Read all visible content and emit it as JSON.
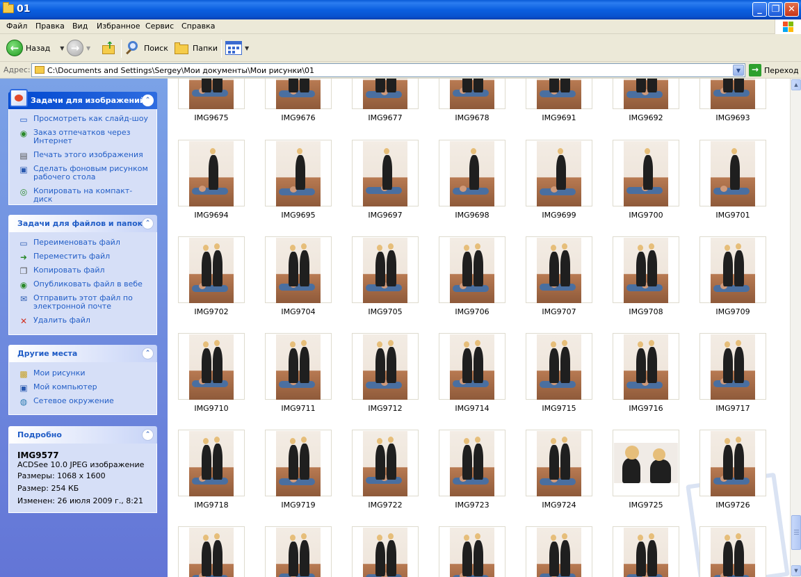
{
  "window": {
    "title": "01",
    "minimize": "_",
    "maximize": "❐",
    "close": "✕"
  },
  "menu": [
    "Файл",
    "Правка",
    "Вид",
    "Избранное",
    "Сервис",
    "Справка"
  ],
  "toolbar": {
    "back_label": "Назад",
    "search_label": "Поиск",
    "folders_label": "Папки"
  },
  "address": {
    "label": "Адрес:",
    "path": "C:\\Documents and Settings\\Sergey\\Мои документы\\Мои рисунки\\01",
    "go_label": "Переход"
  },
  "panels": {
    "image_tasks": {
      "title": "Задачи для изображений",
      "items": [
        {
          "label": "Просмотреть как слайд-шоу",
          "icon": "slideshow-icon"
        },
        {
          "label": "Заказ отпечатков через Интернет",
          "icon": "order-prints-icon"
        },
        {
          "label": "Печать этого изображения",
          "icon": "print-icon"
        },
        {
          "label": "Сделать фоновым рисунком рабочего стола",
          "icon": "desktop-background-icon"
        },
        {
          "label": "Копировать на компакт-диск",
          "icon": "cd-icon"
        }
      ]
    },
    "file_tasks": {
      "title": "Задачи для файлов и папок",
      "items": [
        {
          "label": "Переименовать файл",
          "icon": "rename-icon"
        },
        {
          "label": "Переместить файл",
          "icon": "move-icon"
        },
        {
          "label": "Копировать файл",
          "icon": "copy-icon"
        },
        {
          "label": "Опубликовать файл в вебе",
          "icon": "publish-web-icon"
        },
        {
          "label": "Отправить этот файл по электронной почте",
          "icon": "email-icon"
        },
        {
          "label": "Удалить файл",
          "icon": "delete-icon"
        }
      ]
    },
    "other_places": {
      "title": "Другие места",
      "items": [
        {
          "label": "Мои рисунки",
          "icon": "my-pictures-icon"
        },
        {
          "label": "Мой компьютер",
          "icon": "my-computer-icon"
        },
        {
          "label": "Сетевое окружение",
          "icon": "network-icon"
        }
      ]
    },
    "details": {
      "title": "Подробно",
      "name": "IMG9577",
      "type": "ACDSee 10.0 JPEG изображение",
      "dimensions": "Размеры: 1068 x 1600",
      "size": "Размер: 254 КБ",
      "modified": "Изменен: 26 июля 2009 г., 8:21"
    }
  },
  "thumbnails": [
    [
      "IMG9675",
      "IMG9676",
      "IMG9677",
      "IMG9678",
      "IMG9691",
      "IMG9692",
      "IMG9693"
    ],
    [
      "IMG9694",
      "IMG9695",
      "IMG9697",
      "IMG9698",
      "IMG9699",
      "IMG9700",
      "IMG9701"
    ],
    [
      "IMG9702",
      "IMG9704",
      "IMG9705",
      "IMG9706",
      "IMG9707",
      "IMG9708",
      "IMG9709"
    ],
    [
      "IMG9710",
      "IMG9711",
      "IMG9712",
      "IMG9714",
      "IMG9715",
      "IMG9716",
      "IMG9717"
    ],
    [
      "IMG9718",
      "IMG9719",
      "IMG9722",
      "IMG9723",
      "IMG9724",
      "IMG9725",
      "IMG9726"
    ],
    [
      "",
      "",
      "",
      "",
      "",
      "",
      ""
    ]
  ]
}
